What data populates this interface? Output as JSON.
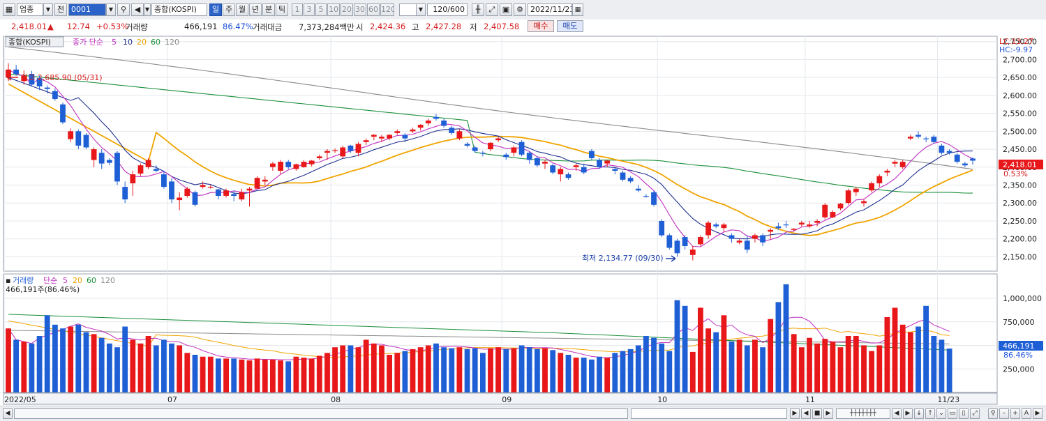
{
  "toolbar": {
    "category_value": "업종",
    "period_label": "전",
    "code_value": "0001",
    "name_value": "종합(KOSPI)",
    "periods": [
      "일",
      "주",
      "월",
      "년",
      "분",
      "틱"
    ],
    "active_period": "일",
    "intervals": [
      "1",
      "3",
      "5",
      "10",
      "20",
      "30",
      "60",
      "120"
    ],
    "count_value": "120/600",
    "date_value": "2022/11/23"
  },
  "quote": {
    "price": "2,418.01",
    "arrow": "▲",
    "change": "12.74",
    "change_pct": "+0.53%",
    "volume_label": "거래량",
    "volume": "466,191",
    "volume_ratio": "86.47%",
    "amount_label": "거래대금",
    "amount": "7,373,284백만",
    "open_label": "시",
    "open": "2,424.36",
    "high_label": "고",
    "high": "2,427.28",
    "low_label": "저",
    "low": "2,407.58",
    "buy_label": "매수",
    "sell_label": "매도"
  },
  "price_legend": {
    "name": "종합(KOSPI)",
    "ma_label": "종가 단순",
    "periods": [
      "5",
      "10",
      "20",
      "60",
      "120"
    ]
  },
  "volume_legend": {
    "name": "거래량",
    "ma_label": "단순",
    "periods": [
      "5",
      "20",
      "60",
      "120"
    ],
    "value_text": "466,191주(86.46%)"
  },
  "annotations": {
    "high_text": "최고 2,685.90 (05/31)",
    "low_text": "최저 2,134.77 (09/30)",
    "lc_text": "LC:13.27",
    "hc_text": "HC:-9.97",
    "last_price_box": "2,418.01",
    "last_pct": "0.53%",
    "vol_box": "466,191",
    "vol_pct": "86.46%"
  },
  "colors": {
    "up": "#e8171a",
    "down": "#1f5fd6",
    "ma5": "#c12fbf",
    "ma10": "#1f2f8f",
    "ma20": "#f0a400",
    "ma60": "#1a8f3a",
    "ma120": "#8a8a8a"
  },
  "chart_data": {
    "type": "candlestick",
    "price_ylim": [
      2110,
      2765
    ],
    "price_ticks": [
      "2,150.00",
      "2,200.00",
      "2,250.00",
      "2,300.00",
      "2,350.00",
      "2,400.00",
      "2,450.00",
      "2,500.00",
      "2,550.00",
      "2,600.00",
      "2,650.00",
      "2,700.00",
      "2,750.00"
    ],
    "volume_ylim": [
      0,
      1200000
    ],
    "volume_ticks": [
      "250,000",
      "500,000",
      "750,000",
      "1,000,000"
    ],
    "x_labels": [
      {
        "i": 0,
        "t": "2022/05"
      },
      {
        "i": 21,
        "t": "07"
      },
      {
        "i": 42,
        "t": "08"
      },
      {
        "i": 64,
        "t": "09"
      },
      {
        "i": 84,
        "t": "10"
      },
      {
        "i": 103,
        "t": "11"
      },
      {
        "i": 120,
        "t": "11/23"
      }
    ],
    "ohlc": [
      [
        2650,
        2690,
        2640,
        2672
      ],
      [
        2672,
        2685,
        2655,
        2660
      ],
      [
        2640,
        2670,
        2630,
        2655
      ],
      [
        2660,
        2668,
        2625,
        2630
      ],
      [
        2648,
        2655,
        2615,
        2625
      ],
      [
        2622,
        2628,
        2605,
        2618
      ],
      [
        2612,
        2620,
        2585,
        2590
      ],
      [
        2575,
        2580,
        2520,
        2525
      ],
      [
        2478,
        2508,
        2470,
        2500
      ],
      [
        2500,
        2505,
        2450,
        2460
      ],
      [
        2490,
        2495,
        2450,
        2455
      ],
      [
        2420,
        2455,
        2400,
        2450
      ],
      [
        2440,
        2450,
        2395,
        2410
      ],
      [
        2420,
        2425,
        2405,
        2412
      ],
      [
        2440,
        2445,
        2350,
        2360
      ],
      [
        2345,
        2360,
        2300,
        2310
      ],
      [
        2355,
        2390,
        2320,
        2380
      ],
      [
        2382,
        2410,
        2375,
        2405
      ],
      [
        2400,
        2425,
        2395,
        2420
      ],
      [
        2395,
        2405,
        2385,
        2390
      ],
      [
        2380,
        2390,
        2340,
        2345
      ],
      [
        2360,
        2370,
        2300,
        2310
      ],
      [
        2308,
        2330,
        2280,
        2315
      ],
      [
        2320,
        2345,
        2315,
        2340
      ],
      [
        2330,
        2335,
        2290,
        2295
      ],
      [
        2345,
        2360,
        2340,
        2350
      ],
      [
        2345,
        2350,
        2340,
        2345
      ],
      [
        2338,
        2340,
        2310,
        2320
      ],
      [
        2320,
        2340,
        2315,
        2335
      ],
      [
        2325,
        2335,
        2305,
        2320
      ],
      [
        2310,
        2340,
        2305,
        2330
      ],
      [
        2335,
        2345,
        2290,
        2340
      ],
      [
        2340,
        2375,
        2340,
        2370
      ],
      [
        2360,
        2375,
        2350,
        2365
      ],
      [
        2400,
        2415,
        2390,
        2410
      ],
      [
        2390,
        2420,
        2380,
        2415
      ],
      [
        2415,
        2420,
        2395,
        2400
      ],
      [
        2395,
        2410,
        2390,
        2408
      ],
      [
        2400,
        2420,
        2398,
        2415
      ],
      [
        2408,
        2420,
        2402,
        2418
      ],
      [
        2425,
        2435,
        2420,
        2430
      ],
      [
        2440,
        2450,
        2420,
        2445
      ],
      [
        2445,
        2452,
        2440,
        2447
      ],
      [
        2430,
        2460,
        2425,
        2455
      ],
      [
        2460,
        2462,
        2440,
        2445
      ],
      [
        2440,
        2470,
        2430,
        2465
      ],
      [
        2470,
        2480,
        2462,
        2475
      ],
      [
        2485,
        2492,
        2475,
        2490
      ],
      [
        2480,
        2490,
        2470,
        2485
      ],
      [
        2480,
        2492,
        2475,
        2490
      ],
      [
        2495,
        2505,
        2490,
        2500
      ],
      [
        2490,
        2495,
        2470,
        2480
      ],
      [
        2500,
        2510,
        2495,
        2505
      ],
      [
        2510,
        2520,
        2502,
        2518
      ],
      [
        2522,
        2535,
        2515,
        2530
      ],
      [
        2540,
        2548,
        2530,
        2535
      ],
      [
        2530,
        2535,
        2510,
        2515
      ],
      [
        2510,
        2515,
        2490,
        2495
      ],
      [
        2480,
        2505,
        2475,
        2500
      ],
      [
        2465,
        2470,
        2455,
        2460
      ],
      [
        2455,
        2460,
        2440,
        2445
      ],
      [
        2440,
        2445,
        2430,
        2438
      ],
      [
        2450,
        2470,
        2445,
        2468
      ],
      [
        2475,
        2485,
        2470,
        2480
      ],
      [
        2435,
        2440,
        2420,
        2428
      ],
      [
        2440,
        2460,
        2430,
        2455
      ],
      [
        2470,
        2475,
        2430,
        2435
      ],
      [
        2440,
        2445,
        2410,
        2420
      ],
      [
        2425,
        2430,
        2400,
        2405
      ],
      [
        2410,
        2420,
        2395,
        2415
      ],
      [
        2405,
        2410,
        2380,
        2385
      ],
      [
        2380,
        2400,
        2360,
        2395
      ],
      [
        2380,
        2385,
        2365,
        2370
      ],
      [
        2400,
        2410,
        2390,
        2405
      ],
      [
        2400,
        2410,
        2380,
        2385
      ],
      [
        2445,
        2450,
        2420,
        2425
      ],
      [
        2420,
        2425,
        2395,
        2400
      ],
      [
        2410,
        2420,
        2400,
        2418
      ],
      [
        2395,
        2400,
        2380,
        2390
      ],
      [
        2385,
        2390,
        2360,
        2365
      ],
      [
        2370,
        2375,
        2355,
        2360
      ],
      [
        2340,
        2350,
        2330,
        2335
      ],
      [
        2320,
        2325,
        2315,
        2318
      ],
      [
        2330,
        2335,
        2290,
        2295
      ],
      [
        2250,
        2255,
        2205,
        2210
      ],
      [
        2210,
        2215,
        2170,
        2175
      ],
      [
        2195,
        2200,
        2150,
        2160
      ],
      [
        2205,
        2210,
        2170,
        2180
      ],
      [
        2155,
        2180,
        2140,
        2170
      ],
      [
        2185,
        2210,
        2180,
        2205
      ],
      [
        2210,
        2250,
        2200,
        2245
      ],
      [
        2240,
        2245,
        2230,
        2235
      ],
      [
        2230,
        2245,
        2220,
        2240
      ],
      [
        2210,
        2215,
        2190,
        2200
      ],
      [
        2190,
        2200,
        2185,
        2195
      ],
      [
        2195,
        2210,
        2160,
        2170
      ],
      [
        2200,
        2215,
        2190,
        2210
      ],
      [
        2210,
        2215,
        2180,
        2190
      ],
      [
        2220,
        2230,
        2200,
        2225
      ],
      [
        2235,
        2245,
        2225,
        2230
      ],
      [
        2240,
        2250,
        2230,
        2238
      ],
      [
        2225,
        2230,
        2220,
        2228
      ],
      [
        2240,
        2250,
        2235,
        2245
      ],
      [
        2235,
        2250,
        2230,
        2240
      ],
      [
        2245,
        2255,
        2235,
        2250
      ],
      [
        2260,
        2300,
        2255,
        2295
      ],
      [
        2260,
        2280,
        2258,
        2275
      ],
      [
        2285,
        2300,
        2280,
        2298
      ],
      [
        2300,
        2340,
        2295,
        2335
      ],
      [
        2330,
        2345,
        2320,
        2340
      ],
      [
        2300,
        2310,
        2290,
        2305
      ],
      [
        2335,
        2360,
        2330,
        2355
      ],
      [
        2355,
        2380,
        2345,
        2375
      ],
      [
        2385,
        2395,
        2375,
        2390
      ],
      [
        2410,
        2420,
        2400,
        2415
      ],
      [
        2400,
        2420,
        2395,
        2415
      ],
      [
        2480,
        2490,
        2475,
        2485
      ],
      [
        2490,
        2500,
        2480,
        2485
      ],
      [
        2480,
        2485,
        2470,
        2478
      ],
      [
        2485,
        2490,
        2465,
        2470
      ],
      [
        2460,
        2465,
        2435,
        2440
      ],
      [
        2445,
        2450,
        2435,
        2440
      ],
      [
        2435,
        2440,
        2410,
        2415
      ],
      [
        2410,
        2415,
        2400,
        2405
      ],
      [
        2424,
        2427,
        2407,
        2418
      ]
    ],
    "volume": [
      680000,
      560000,
      540000,
      520000,
      600000,
      820000,
      720000,
      680000,
      700000,
      720000,
      640000,
      620000,
      580000,
      520000,
      480000,
      700000,
      560000,
      520000,
      600000,
      500000,
      560000,
      520000,
      500000,
      420000,
      400000,
      380000,
      380000,
      360000,
      360000,
      360000,
      350000,
      340000,
      360000,
      350000,
      350000,
      340000,
      330000,
      380000,
      370000,
      360000,
      390000,
      420000,
      480000,
      500000,
      500000,
      480000,
      560000,
      520000,
      500000,
      400000,
      420000,
      440000,
      460000,
      480000,
      500000,
      520000,
      480000,
      470000,
      480000,
      460000,
      470000,
      420000,
      470000,
      480000,
      460000,
      470000,
      500000,
      480000,
      460000,
      470000,
      450000,
      420000,
      400000,
      370000,
      370000,
      350000,
      380000,
      370000,
      420000,
      440000,
      460000,
      500000,
      600000,
      580000,
      520000,
      440000,
      980000,
      920000,
      430000,
      900000,
      680000,
      640000,
      820000,
      540000,
      560000,
      500000,
      560000,
      480000,
      780000,
      960000,
      1150000,
      620000,
      480000,
      580000,
      520000,
      570000,
      540000,
      480000,
      600000,
      600000,
      500000,
      440000,
      500000,
      800000,
      900000,
      720000,
      640000,
      700000,
      920000,
      600000,
      560000,
      466191
    ],
    "ma5": [],
    "ma10": [],
    "ma20": [],
    "ma60": [],
    "ma120": []
  }
}
